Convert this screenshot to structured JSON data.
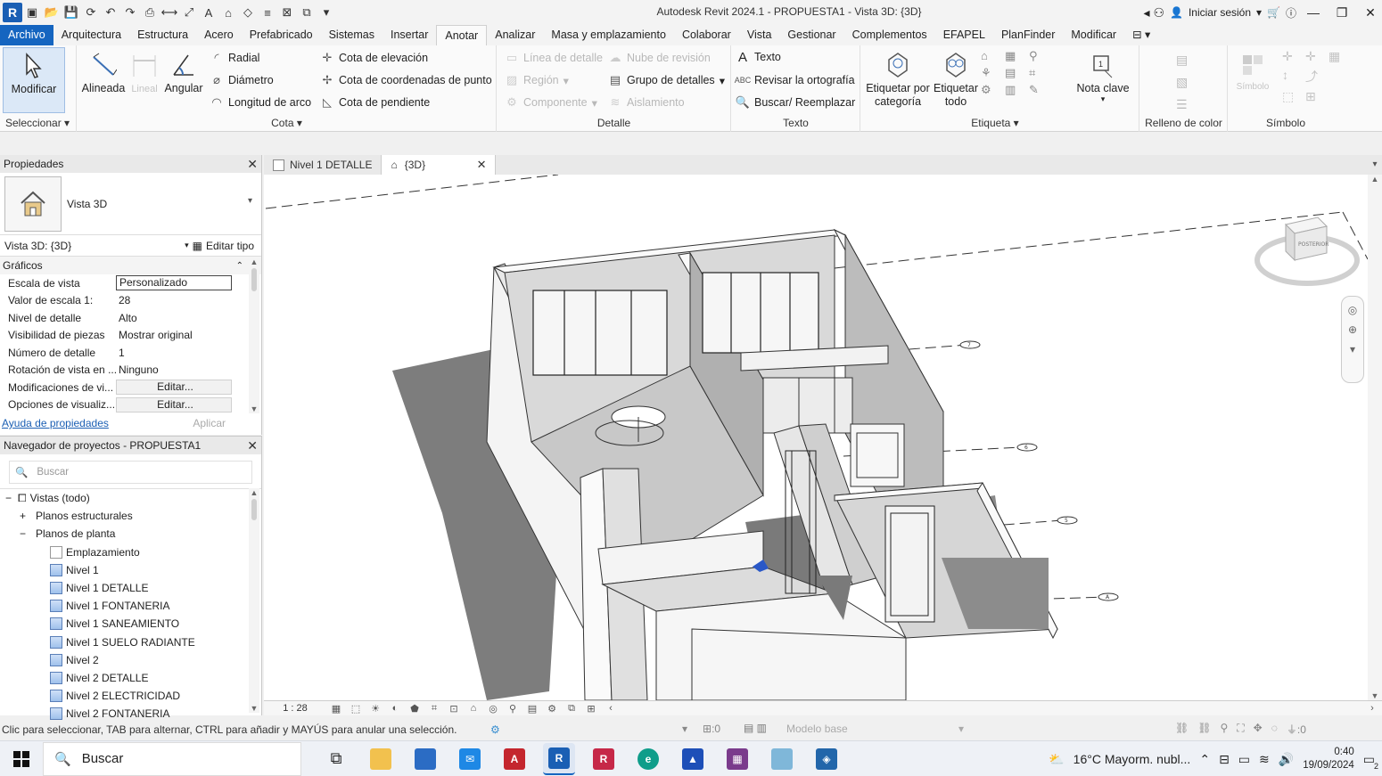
{
  "window": {
    "title": "Autodesk Revit 2024.1 - PROPUESTA1 - Vista 3D: {3D}",
    "app_badge": "R",
    "signin": "Iniciar sesión"
  },
  "ribbon_tabs": [
    "Archivo",
    "Arquitectura",
    "Estructura",
    "Acero",
    "Prefabricado",
    "Sistemas",
    "Insertar",
    "Anotar",
    "Analizar",
    "Masa y emplazamiento",
    "Colaborar",
    "Vista",
    "Gestionar",
    "Complementos",
    "EFAPEL",
    "PlanFinder",
    "Modificar"
  ],
  "active_tab": "Anotar",
  "ribbon": {
    "modify_label": "Modificar",
    "select_panel": "Seleccionar",
    "dim": {
      "aligned": "Alineada",
      "linear": "Lineal",
      "angular": "Angular",
      "radial": "Radial",
      "diameter": "Diámetro",
      "arc_length": "Longitud de arco",
      "spot_elevation": "Cota de elevación",
      "spot_coordinate": "Cota de coordenadas de punto",
      "spot_slope": "Cota de pendiente",
      "panel_title": "Cota"
    },
    "detail": {
      "detail_line": "Línea de detalle",
      "region": "Región",
      "component": "Componente",
      "revision_cloud": "Nube de revisión",
      "detail_group": "Grupo de detalles",
      "insulation": "Aislamiento",
      "panel_title": "Detalle"
    },
    "text": {
      "text": "Texto",
      "spelling": "Revisar la ortografía",
      "find_replace": "Buscar/ Reemplazar",
      "panel_title": "Texto"
    },
    "tag": {
      "by_category": "Etiquetar por categoría",
      "all": "Etiquetar todo",
      "keynote": "Nota clave",
      "panel_title": "Etiqueta"
    },
    "color_fill": {
      "panel_title": "Relleno de color"
    },
    "symbol": {
      "symbol": "Símbolo",
      "panel_title": "Símbolo"
    }
  },
  "properties": {
    "title": "Propiedades",
    "type_name": "Vista 3D",
    "instance": "Vista 3D: {3D}",
    "edit_type": "Editar tipo",
    "category": "Gráficos",
    "rows": [
      {
        "name": "Escala de vista",
        "value": "Personalizado",
        "kind": "box"
      },
      {
        "name": "Valor de escala    1:",
        "value": "28",
        "kind": "text"
      },
      {
        "name": "Nivel de detalle",
        "value": "Alto",
        "kind": "text"
      },
      {
        "name": "Visibilidad de piezas",
        "value": "Mostrar original",
        "kind": "text"
      },
      {
        "name": "Número de detalle",
        "value": "1",
        "kind": "text"
      },
      {
        "name": "Rotación de vista en ...",
        "value": "Ninguno",
        "kind": "text"
      },
      {
        "name": "Modificaciones de vi...",
        "value": "Editar...",
        "kind": "btn"
      },
      {
        "name": "Opciones de visualiz...",
        "value": "Editar...",
        "kind": "btn"
      }
    ],
    "help_link": "Ayuda de propiedades",
    "apply": "Aplicar"
  },
  "browser": {
    "title": "Navegador de proyectos - PROPUESTA1",
    "search_placeholder": "Buscar",
    "views_root": "Vistas (todo)",
    "structural_plans": "Planos estructurales",
    "floor_plans": "Planos de planta",
    "items": [
      "Emplazamiento",
      "Nivel 1",
      "Nivel 1 DETALLE",
      "Nivel 1 FONTANERIA",
      "Nivel 1 SANEAMIENTO",
      "Nivel 1 SUELO RADIANTE",
      "Nivel 2",
      "Nivel 2 DETALLE",
      "Nivel 2 ELECTRICIDAD",
      "Nivel 2 FONTANERIA"
    ]
  },
  "view_tabs": [
    {
      "label": "Nivel 1 DETALLE"
    },
    {
      "label": "{3D}"
    }
  ],
  "view": {
    "scale": "1 : 28",
    "viewcube_face": "POSTERIOR",
    "grid_labels": [
      "7",
      "6",
      "5",
      "A"
    ]
  },
  "status": {
    "message": "Clic para seleccionar, TAB para alternar, CTRL para añadir y MAYÚS para anular una selección.",
    "worksets_count": ":0",
    "model_base": "Modelo base",
    "filter_count": ":0"
  },
  "taskbar": {
    "search": "Buscar",
    "weather": "16°C  Mayorm. nubl...",
    "time": "0:40",
    "date": "19/09/2024",
    "notification_count": "2"
  },
  "colors": {
    "accent": "#1565c0",
    "revit_blue": "#1a5fb4",
    "acad_red": "#c4262e"
  }
}
